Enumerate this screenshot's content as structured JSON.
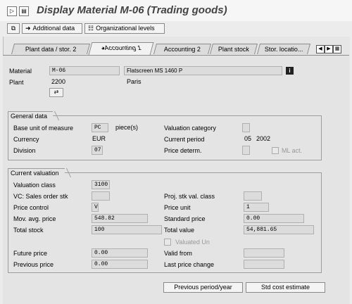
{
  "title": "Display Material M-06 (Trading goods)",
  "toolbar": {
    "additional_data": "Additional data",
    "org_levels": "Organizational levels"
  },
  "tabs": [
    {
      "label": "Plant data / stor. 2"
    },
    {
      "label": "Accounting 1"
    },
    {
      "label": "Accounting 2"
    },
    {
      "label": "Plant stock"
    },
    {
      "label": "Stor. locatio..."
    }
  ],
  "header": {
    "material_label": "Material",
    "material_value": "M-06",
    "material_desc": "Flatscreen MS 1460 P",
    "plant_label": "Plant",
    "plant_value": "2200",
    "plant_desc": "Paris"
  },
  "general": {
    "title": "General data",
    "base_uom_label": "Base unit of measure",
    "base_uom_value": "PC",
    "base_uom_text": "piece(s)",
    "currency_label": "Currency",
    "currency_value": "EUR",
    "division_label": "Division",
    "division_value": "07",
    "valuation_category_label": "Valuation category",
    "current_period_label": "Current period",
    "current_period_value": "05",
    "current_year_value": "2002",
    "price_determ_label": "Price determ.",
    "ml_act_label": "ML act."
  },
  "valuation": {
    "title": "Current valuation",
    "valuation_class_label": "Valuation class",
    "valuation_class_value": "3100",
    "vc_sales_label": "VC: Sales order stk",
    "proj_stk_label": "Proj. stk val. class",
    "price_control_label": "Price control",
    "price_control_value": "V",
    "price_unit_label": "Price unit",
    "price_unit_value": "1",
    "mov_avg_label": "Mov. avg. price",
    "mov_avg_value": "548.82",
    "standard_price_label": "Standard price",
    "standard_price_value": "0.00",
    "total_stock_label": "Total stock",
    "total_stock_value": "100",
    "total_value_label": "Total value",
    "total_value_value": "54,881.65",
    "valuated_un_label": "Valuated Un",
    "future_price_label": "Future price",
    "future_price_value": "0.00",
    "valid_from_label": "Valid from",
    "previous_price_label": "Previous price",
    "previous_price_value": "0.00",
    "last_price_change_label": "Last price change"
  },
  "buttons": {
    "previous_period": "Previous period/year",
    "std_cost": "Std cost estimate"
  },
  "icons": [
    "display-icon",
    "document-icon",
    "copy-icon",
    "arrow-right-icon",
    "org-levels-icon",
    "info-icon",
    "conversion-icon",
    "nav-first-icon",
    "nav-prev-icon",
    "nav-next-icon",
    "nav-last-icon"
  ]
}
